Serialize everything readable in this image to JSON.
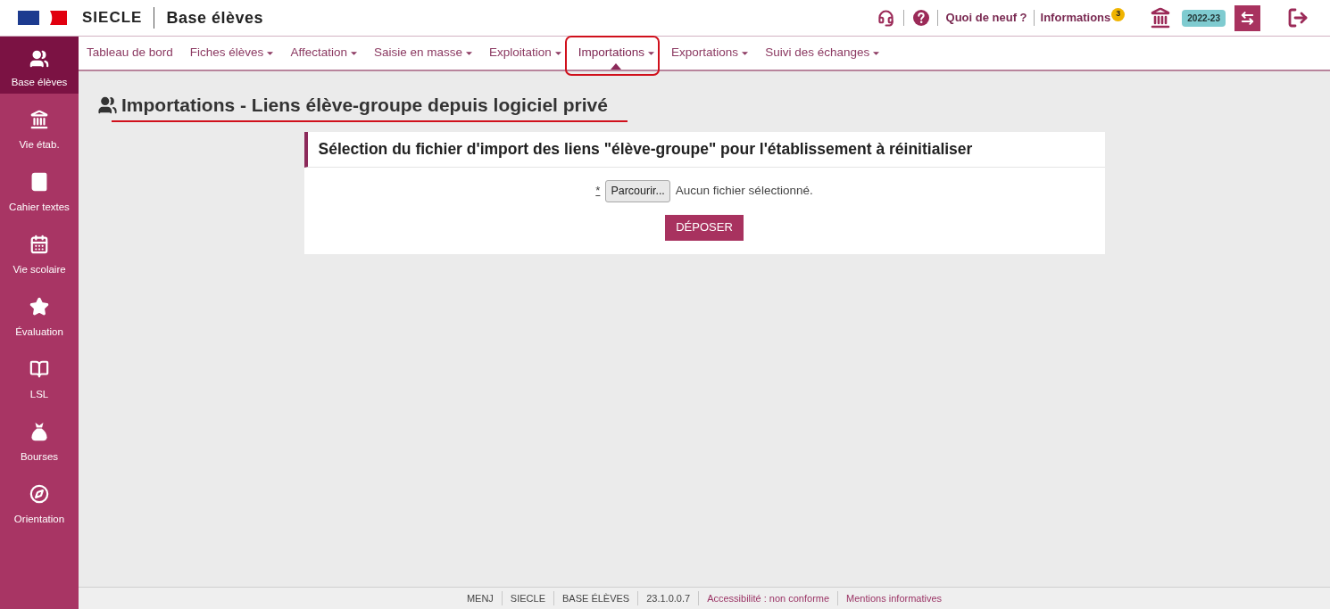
{
  "header": {
    "brand": "SIECLE",
    "module": "Base élèves",
    "links": [
      {
        "label": "Quoi de neuf ?"
      },
      {
        "label": "Informations",
        "badge": "3"
      }
    ],
    "year": "2022-23"
  },
  "sidebar": {
    "items": [
      {
        "label": "Base élèves",
        "selected": true
      },
      {
        "label": "Vie étab.",
        "selected": false
      },
      {
        "label": "Cahier textes",
        "selected": false
      },
      {
        "label": "Vie scolaire",
        "selected": false
      },
      {
        "label": "Évaluation",
        "selected": false
      },
      {
        "label": "LSL",
        "selected": false
      },
      {
        "label": "Bourses",
        "selected": false
      },
      {
        "label": "Orientation",
        "selected": false
      }
    ]
  },
  "nav": {
    "items": [
      {
        "label": "Tableau de bord",
        "dropdown": false,
        "selected": false,
        "circled": false
      },
      {
        "label": "Fiches élèves",
        "dropdown": true,
        "selected": false,
        "circled": false
      },
      {
        "label": "Affectation",
        "dropdown": true,
        "selected": false,
        "circled": false
      },
      {
        "label": "Saisie en masse",
        "dropdown": true,
        "selected": false,
        "circled": false
      },
      {
        "label": "Exploitation",
        "dropdown": true,
        "selected": false,
        "circled": false
      },
      {
        "label": "Importations",
        "dropdown": true,
        "selected": true,
        "circled": true
      },
      {
        "label": "Exportations",
        "dropdown": true,
        "selected": false,
        "circled": false
      },
      {
        "label": "Suivi des échanges",
        "dropdown": true,
        "selected": false,
        "circled": false
      }
    ]
  },
  "page_title": {
    "text": "Importations - Liens élève-groupe depuis logiciel privé",
    "underlined": true
  },
  "upload_panel": {
    "heading": "Sélection du fichier d'import des liens \"élève-groupe\" pour l'établissement à réinitialiser",
    "required_mark": "*",
    "browse_button": "Parcourir...",
    "file_status": "Aucun fichier sélectionné.",
    "submit_button": "DÉPOSER"
  },
  "footer": {
    "items": [
      {
        "label": "MENJ",
        "kind": "text"
      },
      {
        "label": "SIECLE",
        "kind": "text"
      },
      {
        "label": "BASE ÉLÈVES",
        "kind": "text"
      },
      {
        "label": "23.1.0.0.7",
        "kind": "text"
      },
      {
        "label": "Accessibilité : non conforme",
        "kind": "link"
      },
      {
        "label": "Mentions informatives",
        "kind": "link"
      }
    ]
  }
}
